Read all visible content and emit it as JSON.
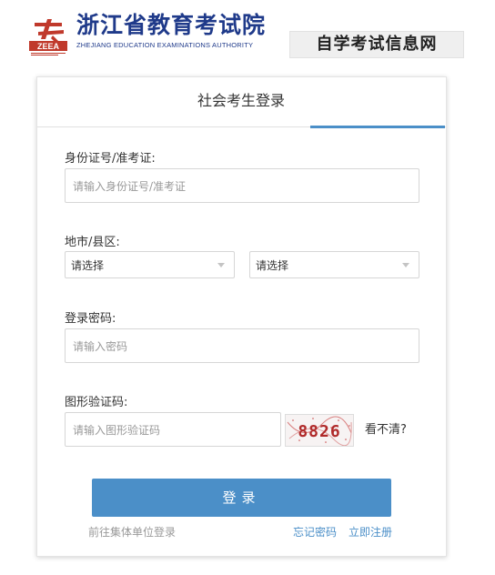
{
  "header": {
    "logo_mark": "ZEEA",
    "title_cn": "浙江省教育考试院",
    "title_en": "ZHEJIANG EDUCATION EXAMINATIONS AUTHORITY",
    "sub_brand": "自学考试信息网"
  },
  "tab": {
    "label": "社会考生登录"
  },
  "form": {
    "id_label": "身份证号/准考证:",
    "id_placeholder": "请输入身份证号/准考证",
    "region_label": "地市/县区:",
    "city_select": "请选择",
    "district_select": "请选择",
    "password_label": "登录密码:",
    "password_placeholder": "请输入密码",
    "captcha_label": "图形验证码:",
    "captcha_placeholder": "请输入图形验证码",
    "captcha_text": "8826",
    "refresh_label": "看不清?"
  },
  "actions": {
    "login_label": "登录",
    "group_login_label": "前往集体单位登录",
    "forgot_password_label": "忘记密码",
    "register_label": "立即注册"
  },
  "colors": {
    "brand": "#1f3a8a",
    "accent": "#4b8fc8",
    "logo_red": "#c0392b",
    "link": "#4b8fc8",
    "muted": "#999999"
  }
}
